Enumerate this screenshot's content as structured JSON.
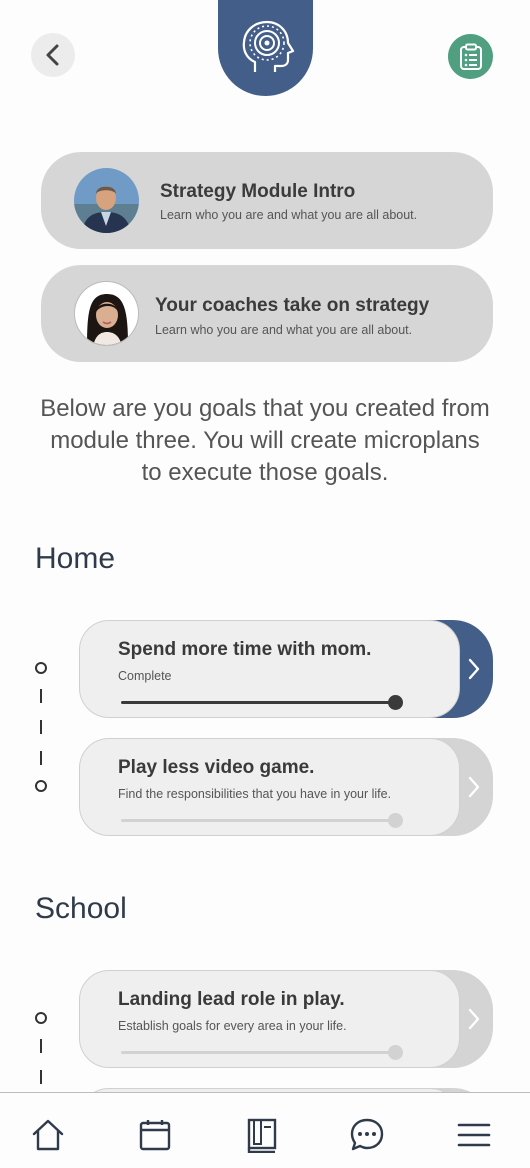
{
  "header": {
    "back_icon": "chevron-left-icon",
    "logo_icon": "head-brain-icon",
    "clipboard_icon": "clipboard-list-icon",
    "colors": {
      "logo_bg": "#435f89",
      "clipboard_bg": "#4f9f80"
    }
  },
  "modules": [
    {
      "title": "Strategy Module Intro",
      "subtitle": "Learn who you are and what you are all about."
    },
    {
      "title": "Your coaches take on strategy",
      "subtitle": "Learn who you are and what you are all about."
    }
  ],
  "intro_text": "Below are you goals that you created from module three. You will create microplans to execute those goals.",
  "sections": [
    {
      "title": "Home",
      "goals": [
        {
          "title": "Spend more time with mom.",
          "subtitle": "Complete",
          "progress": 1.0,
          "complete": true
        },
        {
          "title": "Play less video game.",
          "subtitle": "Find the responsibilities that you have in your life.",
          "progress": 1.0,
          "complete": false
        }
      ]
    },
    {
      "title": "School",
      "goals": [
        {
          "title": "Landing lead role in play.",
          "subtitle": "Establish goals for every area in your life.",
          "progress": 1.0,
          "complete": false
        }
      ]
    }
  ],
  "bottom_nav": [
    {
      "name": "home",
      "icon": "home-icon"
    },
    {
      "name": "calendar",
      "icon": "calendar-icon"
    },
    {
      "name": "book",
      "icon": "book-icon"
    },
    {
      "name": "chat",
      "icon": "chat-icon"
    },
    {
      "name": "menu",
      "icon": "menu-icon"
    }
  ],
  "colors": {
    "accent": "#435f89",
    "inactive_tab": "#d4d4d4",
    "card_bg": "#efefef"
  }
}
